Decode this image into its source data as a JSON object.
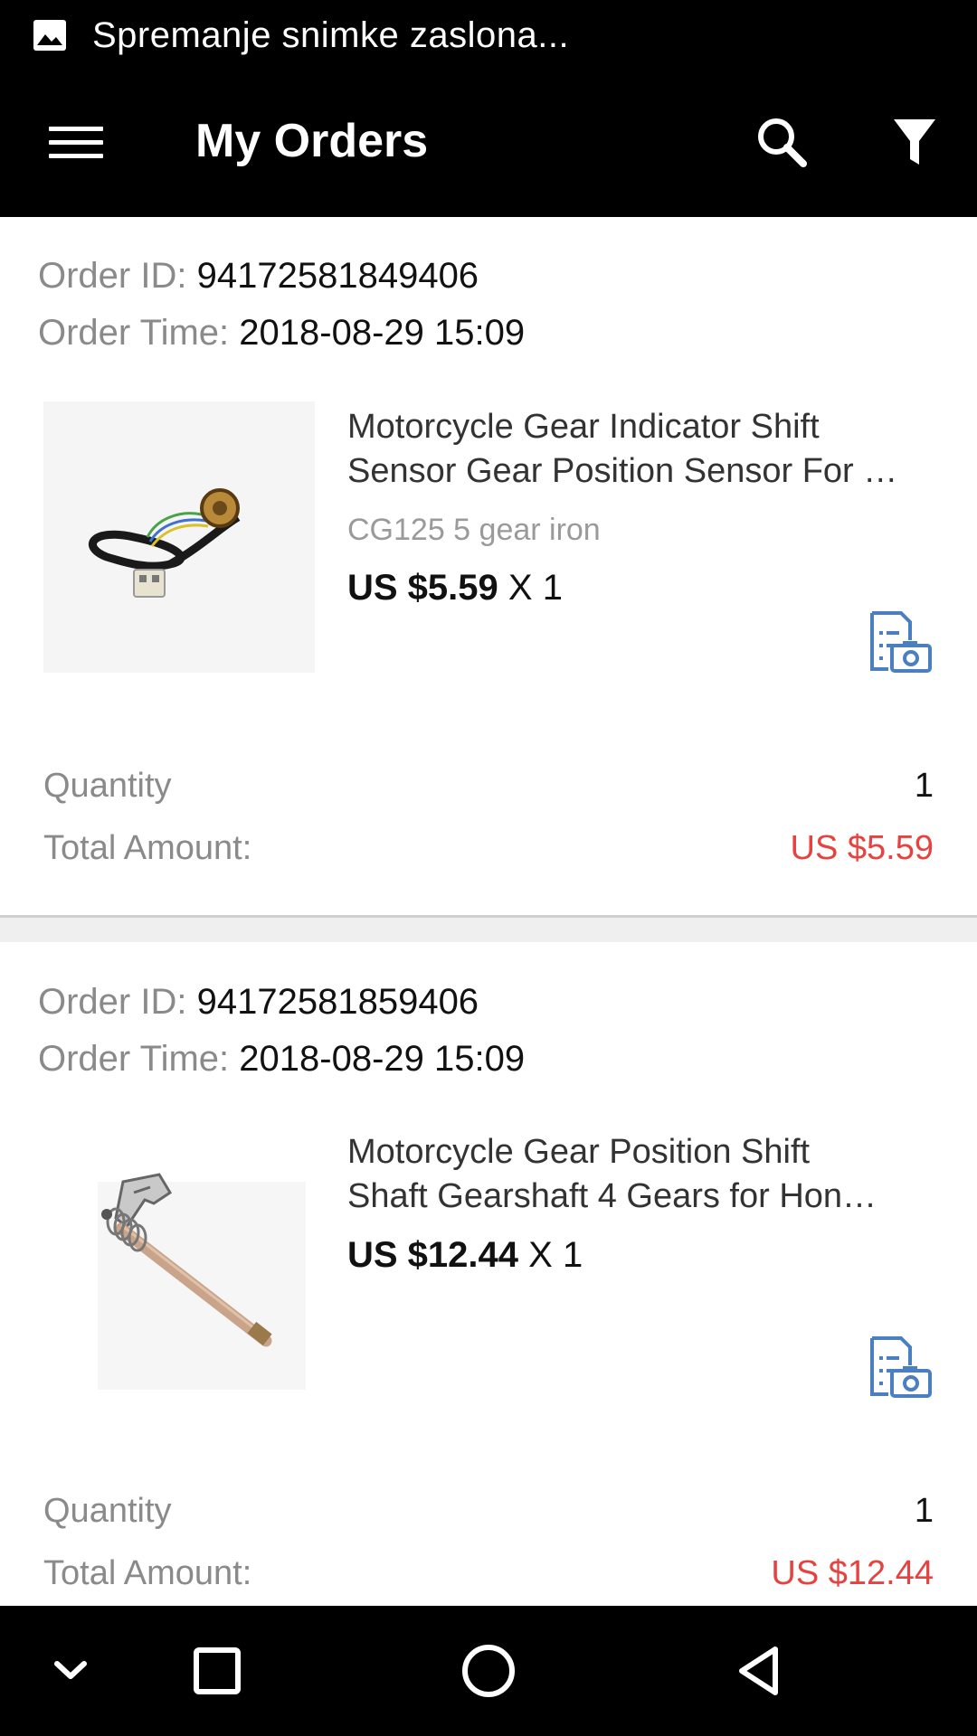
{
  "status_bar": {
    "notification_text": "Spremanje snimke zaslona...",
    "icon": "image-icon"
  },
  "app_bar": {
    "title": "My Orders",
    "icons": [
      "menu-icon",
      "search-icon",
      "filter-icon"
    ]
  },
  "orders": [
    {
      "order_id_label": "Order ID:",
      "order_id": "94172581849406",
      "order_time_label": "Order Time:",
      "order_time": "2018-08-29 15:09",
      "product": {
        "image": "motorcycle-gear-sensor-image",
        "title_line1": "Motorcycle Gear Indicator Shift",
        "title_line2": "Sensor Gear Position Sensor For …",
        "variant": "CG125 5 gear iron",
        "price": "US $5.59",
        "qty_text": "X 1"
      },
      "quantity_label": "Quantity",
      "quantity": "1",
      "total_label": "Total Amount:",
      "total": "US $5.59"
    },
    {
      "order_id_label": "Order ID:",
      "order_id": "94172581859406",
      "order_time_label": "Order Time:",
      "order_time": "2018-08-29 15:09",
      "product": {
        "image": "gear-shift-shaft-image",
        "title_line1": "Motorcycle  Gear Position Shift",
        "title_line2": "Shaft Gearshaft 4 Gears for Hon…",
        "price": "US $12.44",
        "qty_text": "X 1"
      },
      "quantity_label": "Quantity",
      "quantity": "1",
      "total_label": "Total Amount:",
      "total": "US $12.44"
    }
  ],
  "colors": {
    "accent_blue": "#4a7fc1",
    "price_red": "#e64340",
    "label_gray": "#8a8a8a",
    "bar_black": "#000000"
  },
  "nav_bar": {
    "icons": [
      "chevron-down-icon",
      "recents-icon",
      "home-icon",
      "back-icon"
    ]
  }
}
